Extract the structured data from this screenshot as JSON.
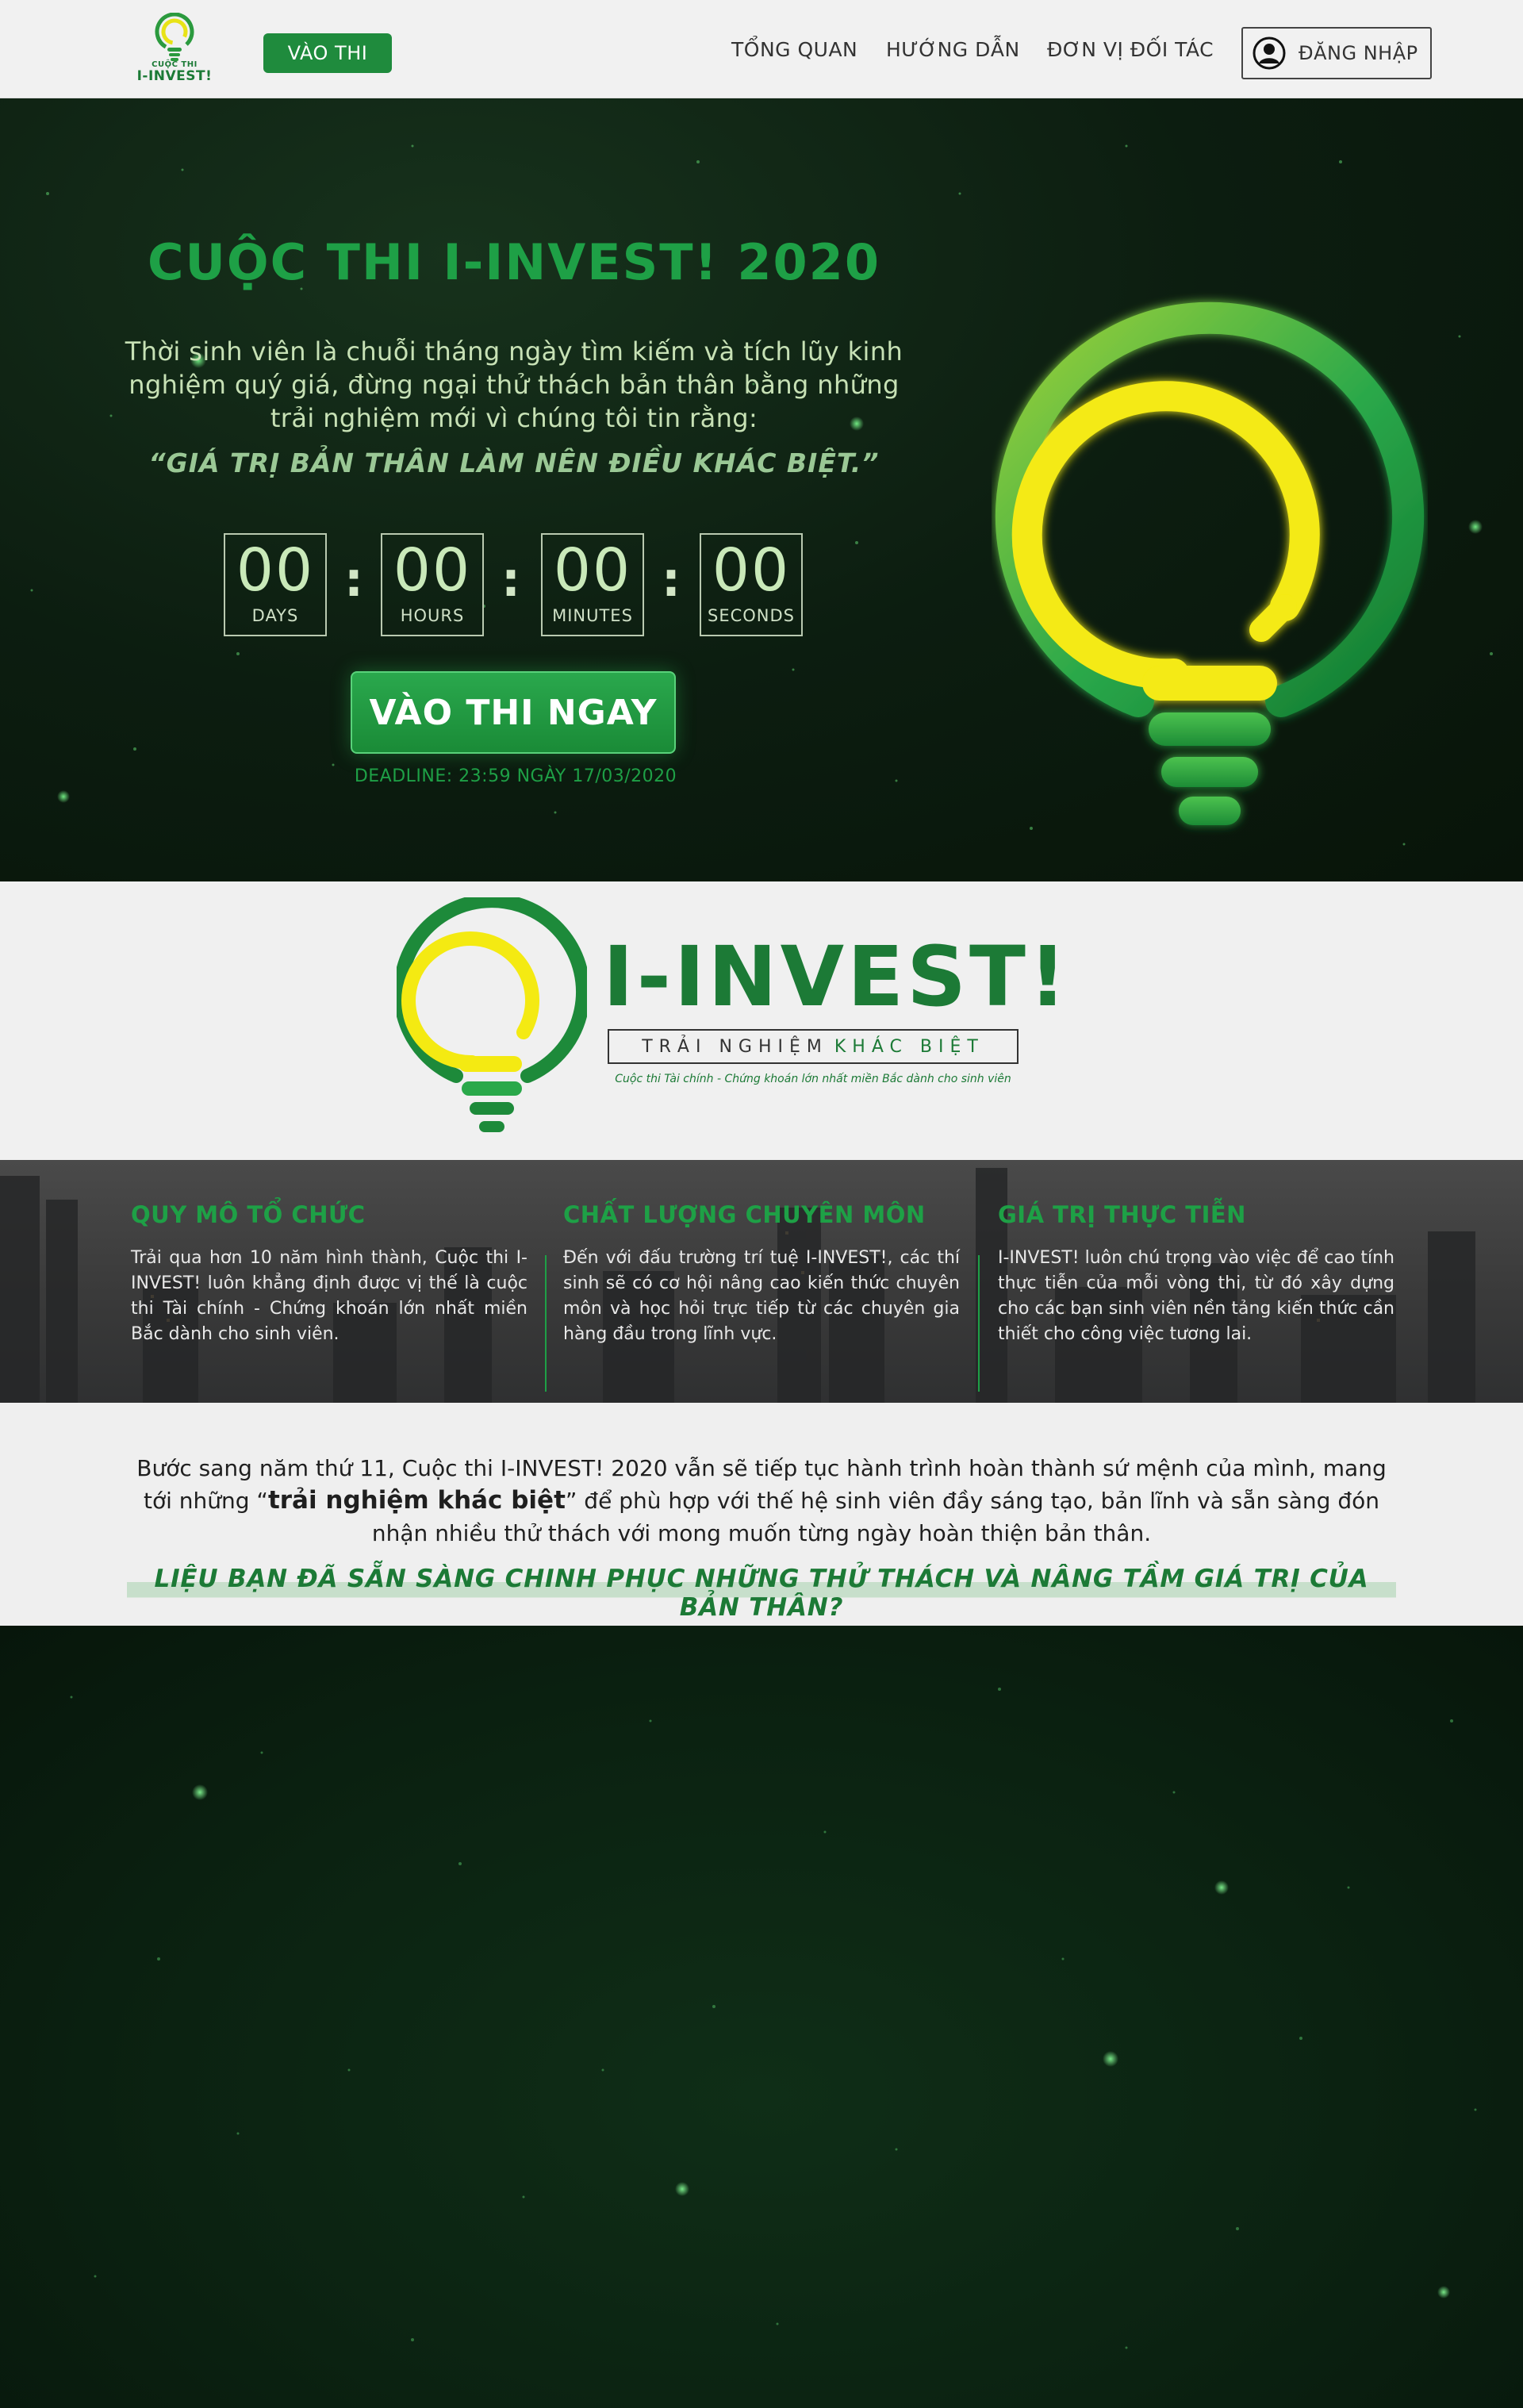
{
  "header": {
    "logo_line1": "CUỘC THI",
    "logo_line2": "I-INVEST!",
    "cta_label": "VÀO THI",
    "nav": [
      "TỔNG QUAN",
      "HƯỚNG DẪN",
      "ĐƠN VỊ ĐỐI TÁC"
    ],
    "login_label": "ĐĂNG NHẬP"
  },
  "hero": {
    "title": "CUỘC THI I-INVEST! 2020",
    "description": "Thời sinh viên là chuỗi tháng ngày tìm kiếm và tích lũy kinh nghiệm quý giá, đừng ngại thử thách bản thân bằng những trải nghiệm mới vì chúng tôi tin rằng:",
    "quote": "“GIÁ TRỊ BẢN THÂN LÀM NÊN ĐIỀU KHÁC BIỆT.”",
    "countdown": {
      "days": "00",
      "days_label": "DAYS",
      "hours": "00",
      "hours_label": "HOURS",
      "minutes": "00",
      "minutes_label": "MINUTES",
      "seconds": "00",
      "seconds_label": "SECONDS",
      "separator": ":"
    },
    "cta_label": "VÀO THI NGAY",
    "deadline": "DEADLINE:  23:59 NGÀY 17/03/2020"
  },
  "brand": {
    "wordmark": "I-INVEST!",
    "tagline_part1": "TRẢI NGHIỆM",
    "tagline_part2": "KHÁC BIỆT",
    "subtagline": "Cuộc thi Tài chính - Chứng khoán lớn nhất miền Bắc dành cho sinh viên"
  },
  "features": [
    {
      "title": "QUY MÔ TỔ CHỨC",
      "text": "Trải qua hơn 10 năm hình thành, Cuộc thi I-INVEST! luôn khẳng định được vị thế là cuộc thi Tài chính - Chứng khoán lớn nhất miền Bắc dành cho sinh viên."
    },
    {
      "title": "CHẤT LƯỢNG CHUYÊN MÔN",
      "text": "Đến với đấu trường trí tuệ I-INVEST!, các thí sinh sẽ có cơ hội nâng cao kiến thức chuyên môn và học hỏi trực tiếp từ các chuyên gia hàng đầu trong lĩnh vực."
    },
    {
      "title": "GIÁ TRỊ THỰC TIỄN",
      "text": "I-INVEST! luôn chú trọng vào việc để cao tính thực tiễn của mỗi vòng thi, từ đó xây dựng cho các bạn sinh viên nền tảng kiến thức cần thiết cho công việc tương lai."
    }
  ],
  "statement": {
    "before": "Bước sang năm thứ 11, Cuộc thi I-INVEST! 2020 vẫn sẽ tiếp tục hành trình hoàn thành sứ mệnh của mình, mang tới những “",
    "bold": "trải nghiệm khác biệt",
    "after": "” để phù hợp với thế hệ sinh viên đầy sáng tạo, bản lĩnh và sẵn sàng đón nhận nhiều thử thách với mong muốn từng ngày hoàn thiện bản thân.",
    "question": "LIỆU BẠN ĐÃ SẴN SÀNG CHINH PHỤC NHỮNG THỬ THÁCH VÀ NÂNG TẦM GIÁ TRỊ CỦA BẢN THÂN?"
  },
  "colors": {
    "brand_green": "#1c7a36",
    "accent_green": "#1ea046",
    "bulb_yellow": "#f4ea12",
    "header_bg": "#f1f1f1",
    "hero_bg": "#0c1d10"
  },
  "icons": {
    "logo": "lightbulb-logo-icon",
    "user": "user-avatar-icon"
  }
}
